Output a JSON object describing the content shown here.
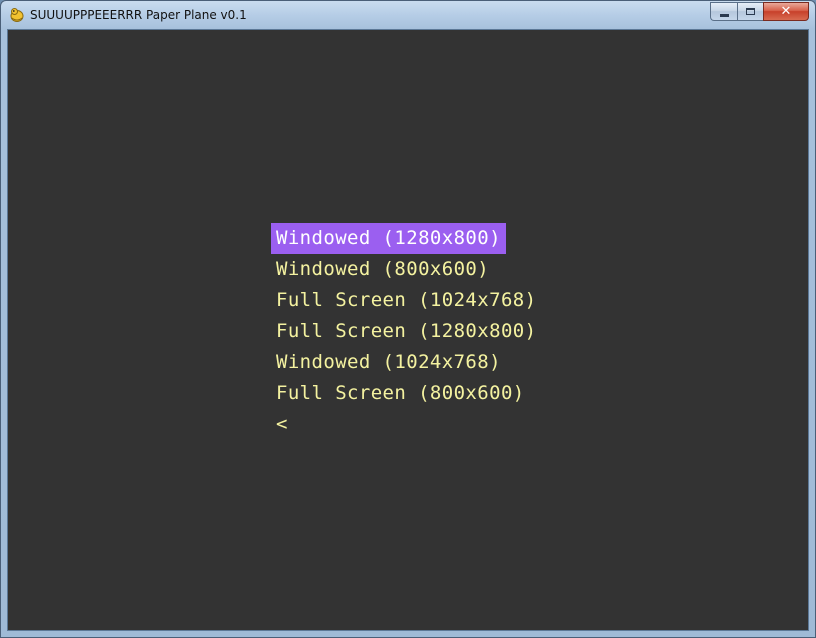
{
  "window": {
    "title": "SUUUUPPPEEERRR Paper Plane v0.1",
    "app_icon": "pygame-snake-icon",
    "controls": {
      "minimize_icon": "minimize-icon",
      "maximize_icon": "maximize-icon",
      "close_label": "✕"
    }
  },
  "menu": {
    "items": [
      {
        "label": "Windowed (1280x800)",
        "selected": true
      },
      {
        "label": "Windowed (800x600)",
        "selected": false
      },
      {
        "label": "Full Screen (1024x768)",
        "selected": false
      },
      {
        "label": "Full Screen (1280x800)",
        "selected": false
      },
      {
        "label": "Windowed (1024x768)",
        "selected": false
      },
      {
        "label": "Full Screen (800x600)",
        "selected": false
      },
      {
        "label": "<",
        "selected": false
      }
    ]
  },
  "colors": {
    "background": "#333333",
    "menu_text": "#f4f2a0",
    "selection_bg": "#9b5ff0",
    "selection_text": "#ffffff"
  }
}
